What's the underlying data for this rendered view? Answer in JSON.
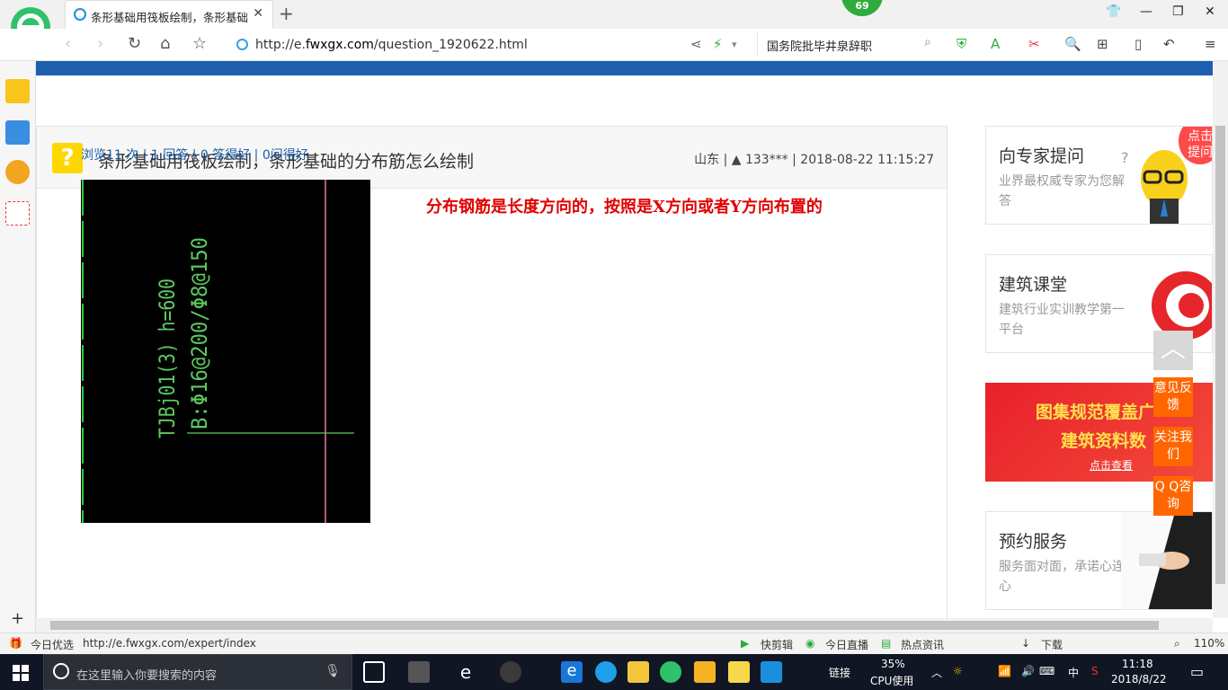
{
  "browser": {
    "tab_title": "条形基础用筏板绘制，条形基础",
    "tab_close": "✕",
    "new_tab": "+",
    "badge": "69",
    "url_prefix": "http://e.",
    "url_domain": "fwxgx.com",
    "url_path": "/question_1920622.html",
    "search_text": "国务院批毕井泉辞职"
  },
  "page": {
    "question_title": "条形基础用筏板绘制，条形基础的分布筋怎么绘制",
    "question_meta": "山东 | ▲ 133*** | 2018-08-22 11:15:27",
    "stats": "浏览11 次 | 1 回答 | 0 答得好 | 0问得好",
    "answer": "分布钢筋是长度方向的，按照是X方向或者Y方向布置的",
    "cad_line1": "TJBj01(3) h=600",
    "cad_line2": "B:Φ16@200/Φ8@150"
  },
  "sidebar_cards": [
    {
      "title": "向专家提问",
      "sub": "业界最权威专家为您解答"
    },
    {
      "title": "建筑课堂",
      "sub": "建筑行业实训教学第一平台"
    },
    {
      "title": "预约服务",
      "sub": "服务面对面，承诺心连心"
    }
  ],
  "banner": {
    "line1": "图集规范覆盖广",
    "line2": "建筑资料数",
    "link": "点击查看",
    "corner": "点击提问"
  },
  "float": {
    "feedback": "意见反馈",
    "follow": "关注我们",
    "qq": "Q Q咨询"
  },
  "status": {
    "left_label": "今日优选",
    "link_url": "http://e.fwxgx.com/expert/index",
    "clip": "快剪辑",
    "live": "今日直播",
    "news": "热点资讯",
    "download": "下载",
    "zoom": "110%"
  },
  "taskbar": {
    "search_placeholder": "在这里输入你要搜索的内容",
    "link": "链接",
    "cpu_pct": "35%",
    "cpu_label": "CPU使用",
    "ime": "中",
    "time": "11:18",
    "date": "2018/8/22"
  }
}
